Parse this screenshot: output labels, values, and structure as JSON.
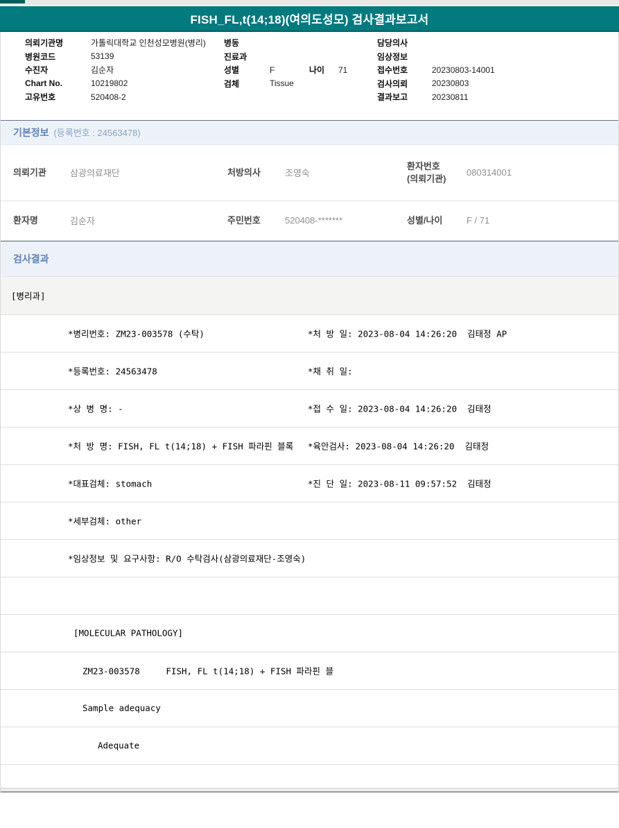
{
  "colors": {
    "header_teal": "#027a7e",
    "header_teal_dark": "#015e5c",
    "section_band_bg": "#edf2f8",
    "section_title_blue": "#5f83b4",
    "value_gray": "#8f8f8f"
  },
  "report_header": {
    "title": "FISH_FL,t(14;18)(여의도성모) 검사결과보고서"
  },
  "admin": {
    "rows": [
      {
        "l1": "의뢰기관명",
        "v1": "가톨릭대학교 인천성모병원(병리)",
        "l2": "병동",
        "v2": "",
        "l3": "담당의사",
        "v3": ""
      },
      {
        "l1": "병원코드",
        "v1": "53139",
        "l2": "진료과",
        "v2": "",
        "l3": "임상정보",
        "v3": ""
      },
      {
        "l1": "수진자",
        "v1": "김순자",
        "l2": "성별",
        "v2": "F",
        "l2b": "나이",
        "v2b": "71",
        "l3": "접수번호",
        "v3": "20230803-14001"
      },
      {
        "l1": "Chart No.",
        "v1": "10219802",
        "l2": "검체",
        "v2": "Tissue",
        "l3": "검사의뢰",
        "v3": "20230803"
      },
      {
        "l1": "고유번호",
        "v1": "520408-2",
        "l3": "결과보고",
        "v3": "20230811"
      }
    ]
  },
  "basic_info": {
    "section_title": "기본정보",
    "section_sub": "(등록번호 : 24563478)",
    "rows": [
      {
        "c1l": "의뢰기관",
        "c1v": "삼광의료재단",
        "c2l": "처방의사",
        "c2v": "조영숙",
        "c3l1": "환자번호",
        "c3l2": "(의뢰기관)",
        "c3v": "080314001"
      },
      {
        "c1l": "환자명",
        "c1v": "김순자",
        "c2l": "주민번호",
        "c2v": "520408-*******",
        "c3l1": "성별/나이",
        "c3l2": "",
        "c3v": "F / 71"
      }
    ]
  },
  "results": {
    "section_title": "검사결과",
    "dept_header": "[병리과]",
    "rows": [
      {
        "left": "*병리번호: ZM23-003578 (수탁)",
        "right": "*처 방 일: 2023-08-04 14:26:20  김태정 AP"
      },
      {
        "left": "*등록번호: 24563478",
        "right": "*채 취 일:"
      },
      {
        "left": "*상 병 명: -",
        "right": "*접 수 일: 2023-08-04 14:26:20  김태정"
      },
      {
        "left": "*처 방 명: FISH, FL t(14;18) + FISH 파라핀 블록",
        "right": "*육안검사: 2023-08-04 14:26:20  김태정"
      },
      {
        "left": "*대표검체: stomach",
        "right": "*진 단 일: 2023-08-11 09:57:52  김태정"
      },
      {
        "left": "*세부검체: other",
        "right": ""
      },
      {
        "left": "*임상정보 및 요구사항: R/O 수탁검사(삼광의료재단-조영숙)",
        "right": ""
      },
      {
        "left": "",
        "right": ""
      },
      {
        "left": "[MOLECULAR PATHOLOGY]",
        "right": ""
      },
      {
        "left": "ZM23-003578     FISH, FL t(14;18) + FISH 파라핀 블",
        "right": ""
      },
      {
        "left": "Sample adequacy",
        "right": ""
      },
      {
        "left": "Adequate",
        "right": ""
      }
    ]
  }
}
